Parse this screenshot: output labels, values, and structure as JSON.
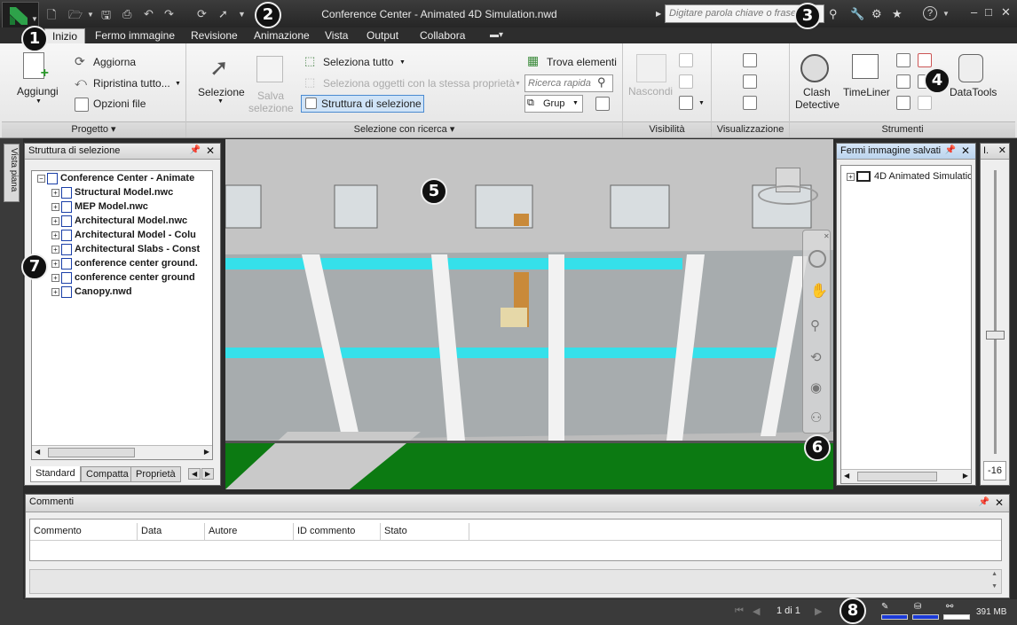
{
  "title": "Conference Center - Animated 4D Simulation.nwd",
  "search_placeholder": "Digitare parola chiave o frase",
  "tabs": [
    "Inizio",
    "Fermo immagine",
    "Revisione",
    "Animazione",
    "Vista",
    "Output",
    "Collabora"
  ],
  "ribbon": {
    "aggiungi": "Aggiungi",
    "aggiorna": "Aggiorna",
    "ripristina": "Ripristina tutto...",
    "opzioni_file": "Opzioni file",
    "selezione": "Selezione",
    "salva_selezione_1": "Salva",
    "salva_selezione_2": "selezione",
    "seleziona_tutto": "Seleziona tutto",
    "seleziona_stessa": "Seleziona oggetti con la stessa proprietà",
    "struttura_selezione": "Struttura di selezione",
    "trova_elementi": "Trova elementi",
    "ricerca_rapida": "Ricerca rapida",
    "grup": "Grup",
    "nascondi": "Nascondi",
    "clash_1": "Clash",
    "clash_2": "Detective",
    "timeliner": "TimeLiner",
    "datatools": "DataTools"
  },
  "groups": {
    "progetto": "Progetto",
    "selezione_ricerca": "Selezione con ricerca",
    "visibilita": "Visibilità",
    "visualizzazione": "Visualizzazione",
    "strumenti": "Strumenti"
  },
  "side_tab": "Vista piana",
  "selection_tree": {
    "title": "Struttura di selezione",
    "root": "Conference Center - Animate",
    "items": [
      "Structural Model.nwc",
      "MEP Model.nwc",
      "Architectural Model.nwc",
      "Architectural Model - Colu",
      "Architectural Slabs - Const",
      "conference center ground.",
      "conference center ground",
      "Canopy.nwd"
    ],
    "bottom_tabs": [
      "Standard",
      "Compatta",
      "Proprietà"
    ]
  },
  "saved_views": {
    "title": "Fermi immagine salvati",
    "item": "4D Animated Simulatio"
  },
  "slider_panel": {
    "title": "I.",
    "value": "-16"
  },
  "comments": {
    "title": "Commenti",
    "columns": [
      "Commento",
      "Data",
      "Autore",
      "ID commento",
      "Stato"
    ]
  },
  "status": {
    "page": "1 di 1",
    "memory": "391 MB"
  },
  "badges": [
    "1",
    "2",
    "3",
    "4",
    "5",
    "6",
    "7",
    "8"
  ]
}
